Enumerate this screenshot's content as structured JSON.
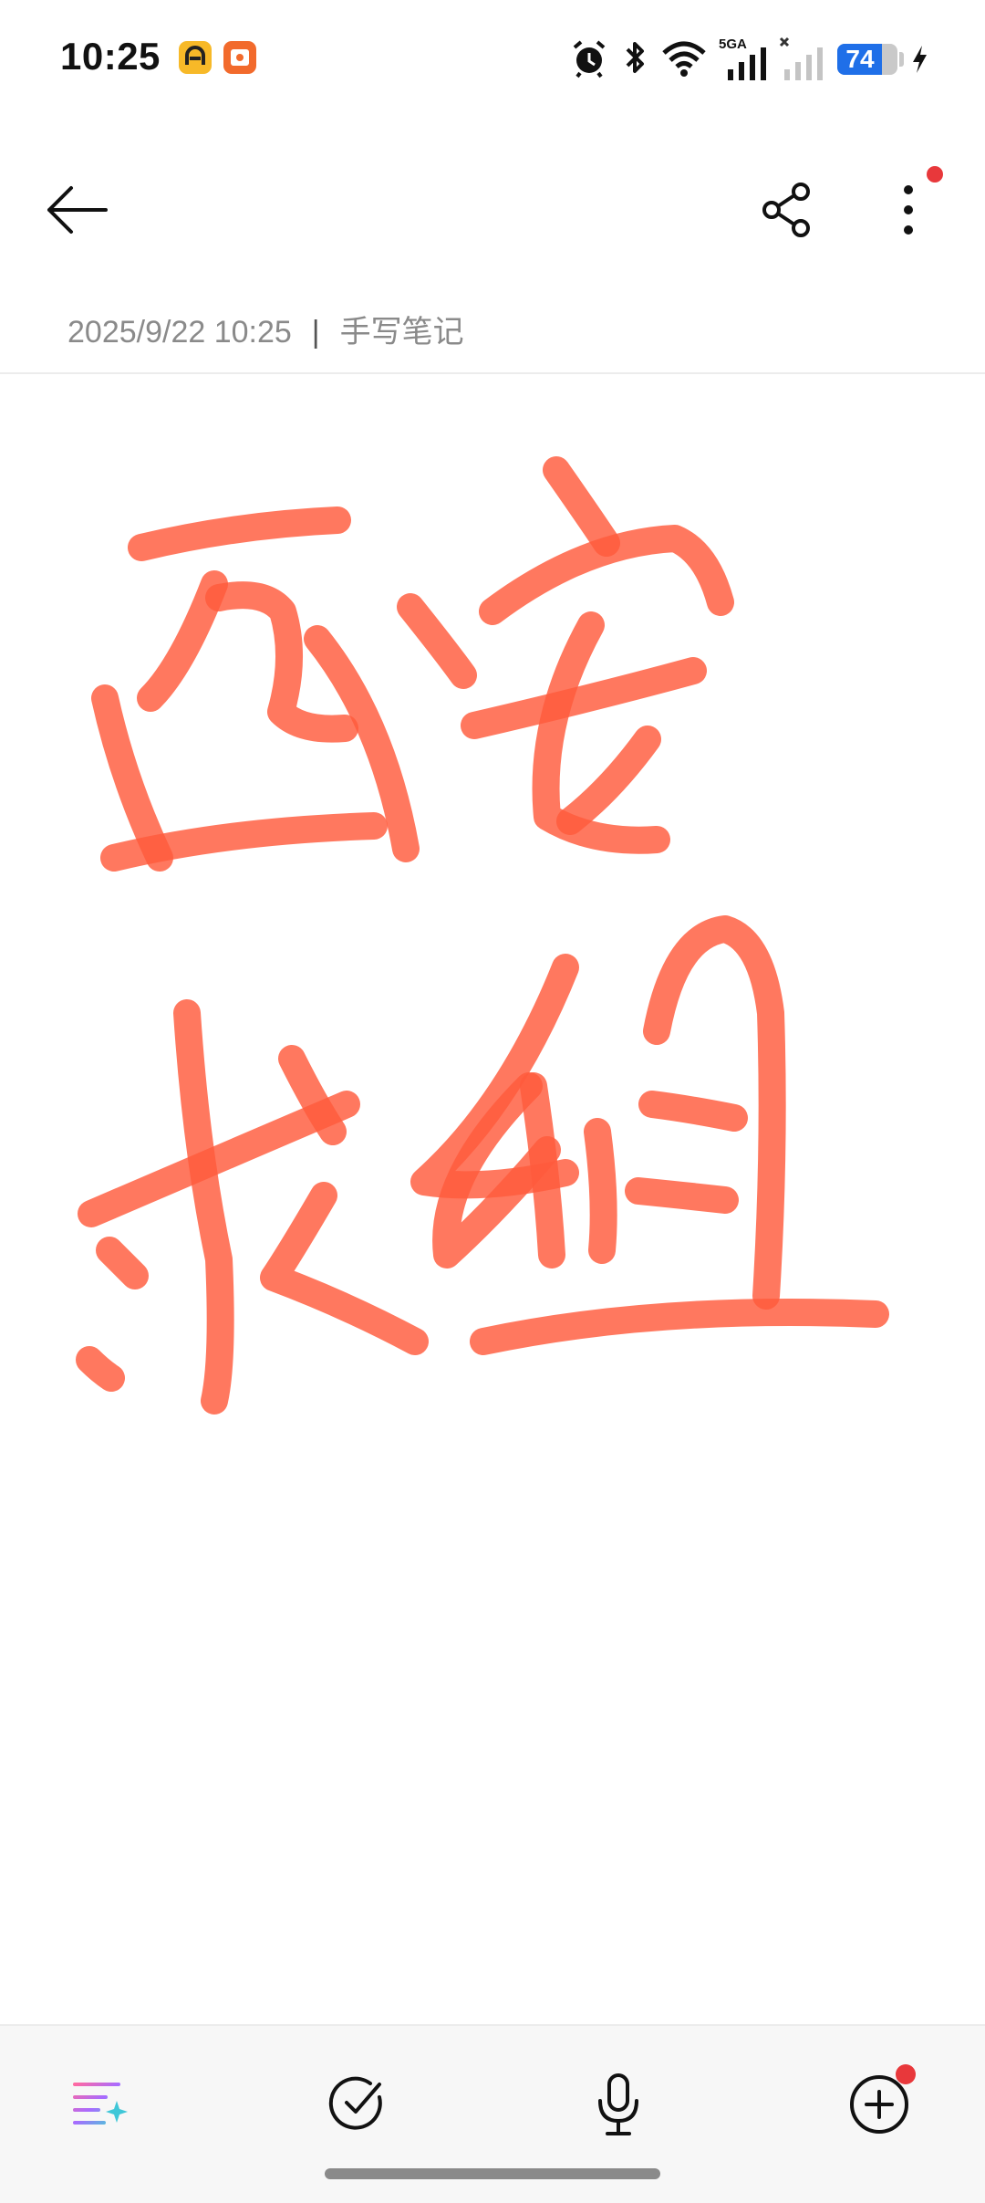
{
  "status_bar": {
    "time": "10:25",
    "network_label": "5GA",
    "battery_level": "74",
    "battery_fraction": 0.74,
    "icons": [
      "app-notification-icon",
      "app-notification-icon",
      "alarm-icon",
      "bluetooth-icon",
      "wifi-icon",
      "signal-5ga-icon",
      "signal-no-service-icon",
      "battery-icon",
      "charging-icon"
    ],
    "colors": {
      "battery_fill": "#1f6fe8",
      "app_icon_1": "#f7b928",
      "app_icon_2": "#f26a2c"
    }
  },
  "toolbar": {
    "back_icon": "arrow-left-icon",
    "share_icon": "share-icon",
    "more_icon": "more-vertical-icon",
    "more_has_badge": true,
    "badge_color": "#e8383b"
  },
  "note": {
    "date": "2025/9/22 10:25",
    "separator": "|",
    "type": "手写笔记",
    "handwriting_text": "西安求组",
    "ink_color": "#ff5a3c"
  },
  "bottom_bar": {
    "buttons": [
      {
        "name": "ai-format-button",
        "icon": "ai-text-sparkle-icon"
      },
      {
        "name": "checklist-button",
        "icon": "check-circle-icon"
      },
      {
        "name": "voice-button",
        "icon": "microphone-icon"
      },
      {
        "name": "add-button",
        "icon": "plus-circle-icon",
        "has_badge": true
      }
    ]
  }
}
